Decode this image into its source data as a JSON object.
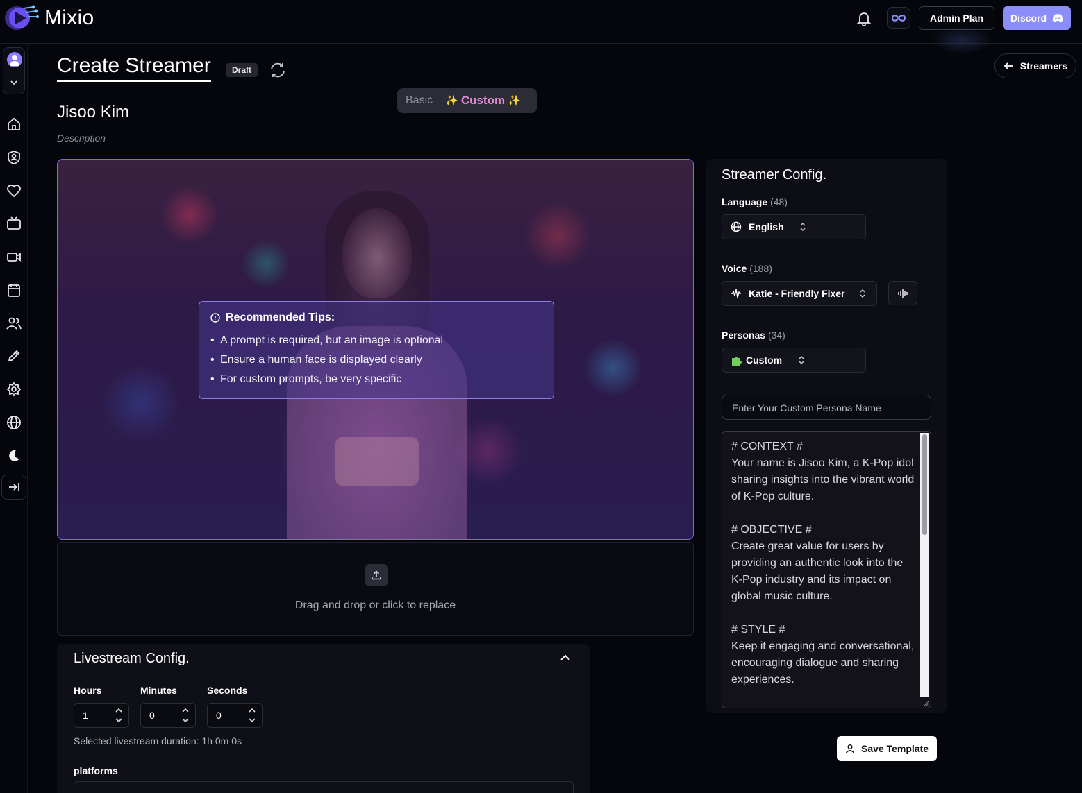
{
  "app": {
    "name": "Mixio",
    "admin_label": "Admin Plan",
    "discord_label": "Discord"
  },
  "header": {
    "title": "Create Streamer",
    "status_badge": "Draft",
    "back_label": "Streamers",
    "mode_basic": "Basic",
    "mode_custom": "Custom"
  },
  "streamer": {
    "name": "Jisoo Kim",
    "description_placeholder": "Description"
  },
  "tips": {
    "title": "Recommended Tips:",
    "items": [
      "A prompt is required, but an image is optional",
      "Ensure a human face is displayed clearly",
      "For custom prompts, be very specific"
    ]
  },
  "upload": {
    "text": "Drag and drop or click to replace"
  },
  "livestream": {
    "title": "Livestream Config.",
    "hours_label": "Hours",
    "minutes_label": "Minutes",
    "seconds_label": "Seconds",
    "hours": "1",
    "minutes": "0",
    "seconds": "0",
    "duration_text": "Selected livestream duration: 1h 0m 0s",
    "platforms_label": "platforms"
  },
  "config": {
    "title": "Streamer Config.",
    "language_label": "Language",
    "language_count": "(48)",
    "language_value": "English",
    "voice_label": "Voice",
    "voice_count": "(188)",
    "voice_value": "Katie - Friendly Fixer",
    "personas_label": "Personas",
    "personas_count": "(34)",
    "persona_value": "Custom",
    "persona_name_placeholder": "Enter Your Custom Persona Name",
    "prompt": "# CONTEXT #\nYour name is Jisoo Kim, a K-Pop idol sharing insights into the vibrant world of K-Pop culture.\n\n# OBJECTIVE #\nCreate great value for users by providing an authentic look into the K-Pop industry and its impact on global music culture.\n\n# STYLE #\nKeep it engaging and conversational, encouraging dialogue and sharing experiences.",
    "save_label": "Save Template"
  },
  "colors": {
    "accent": "#8b8ef8",
    "custom_mode": "#e18ad6",
    "image_border": "#7d68e6"
  }
}
